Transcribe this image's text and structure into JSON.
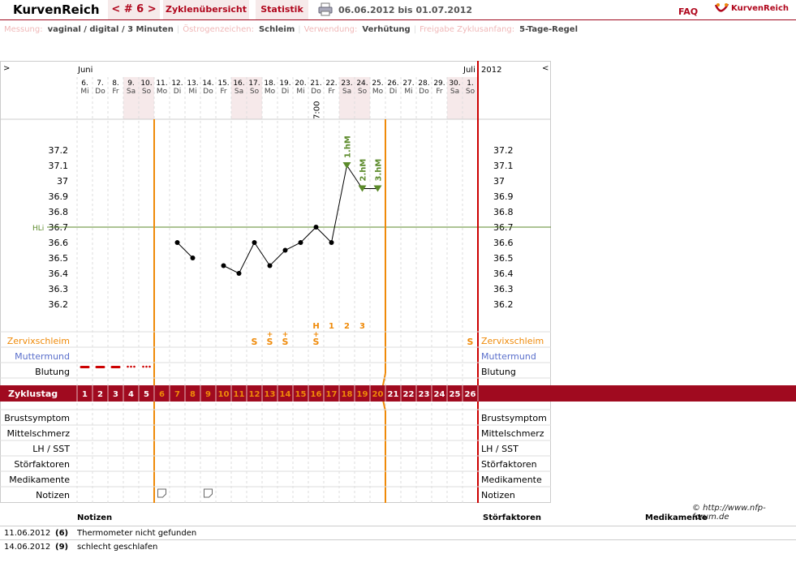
{
  "header": {
    "logo": "KurvenReich",
    "cycle_prev": "<",
    "cycle_num": "# 6",
    "cycle_next": ">",
    "tab_cycles": "Zyklenübersicht",
    "tab_stats": "Statistik",
    "date_range": "06.06.2012 bis 01.07.2012",
    "faq": "FAQ",
    "brand": "KurvenReich"
  },
  "info": [
    {
      "k": "Messung:",
      "v": "vaginal / digital / 3 Minuten"
    },
    {
      "k": "Östrogenzeichen:",
      "v": "Schleim"
    },
    {
      "k": "Verwendung:",
      "v": "Verhütung"
    },
    {
      "k": "Freigabe Zyklusanfang:",
      "v": "5-Tage-Regel"
    }
  ],
  "chart": {
    "nav_left": ">",
    "nav_right": "<",
    "month_start": "Juni",
    "month_end": "Juli",
    "year": "2012",
    "days": [
      {
        "d": "6.",
        "w": "Mi"
      },
      {
        "d": "7.",
        "w": "Do"
      },
      {
        "d": "8.",
        "w": "Fr"
      },
      {
        "d": "9.",
        "w": "Sa"
      },
      {
        "d": "10.",
        "w": "So"
      },
      {
        "d": "11.",
        "w": "Mo"
      },
      {
        "d": "12.",
        "w": "Di"
      },
      {
        "d": "13.",
        "w": "Mi"
      },
      {
        "d": "14.",
        "w": "Do"
      },
      {
        "d": "15.",
        "w": "Fr"
      },
      {
        "d": "16.",
        "w": "Sa"
      },
      {
        "d": "17.",
        "w": "So"
      },
      {
        "d": "18.",
        "w": "Mo"
      },
      {
        "d": "19.",
        "w": "Di"
      },
      {
        "d": "20.",
        "w": "Mi"
      },
      {
        "d": "21.",
        "w": "Do"
      },
      {
        "d": "22.",
        "w": "Fr"
      },
      {
        "d": "23.",
        "w": "Sa"
      },
      {
        "d": "24.",
        "w": "So"
      },
      {
        "d": "25.",
        "w": "Mo"
      },
      {
        "d": "26.",
        "w": "Di"
      },
      {
        "d": "27.",
        "w": "Mi"
      },
      {
        "d": "28.",
        "w": "Do"
      },
      {
        "d": "29.",
        "w": "Fr"
      },
      {
        "d": "30.",
        "w": "Sa"
      },
      {
        "d": "1.",
        "w": "So"
      }
    ],
    "time_label": "7:00",
    "time_day": 16,
    "yticks": [
      "37.2",
      "37.1",
      "37",
      "36.9",
      "36.8",
      "36.7",
      "36.6",
      "36.5",
      "36.4",
      "36.3",
      "36.2"
    ],
    "hili_label": "HLi",
    "hili_value": 36.7,
    "temps": [
      null,
      null,
      null,
      null,
      null,
      null,
      36.6,
      36.5,
      null,
      36.45,
      36.4,
      36.6,
      36.45,
      36.55,
      36.6,
      36.7,
      36.6,
      37.1,
      36.95,
      36.95,
      null,
      null,
      null,
      null,
      null,
      null
    ],
    "peak_labels": [
      {
        "day": 18,
        "t": "1.hM"
      },
      {
        "day": 19,
        "t": "2.hM"
      },
      {
        "day": 20,
        "t": "3.hM"
      }
    ],
    "hl_labels": [
      {
        "day": 16,
        "t": "H"
      },
      {
        "day": 17,
        "t": "1"
      },
      {
        "day": 18,
        "t": "2"
      },
      {
        "day": 19,
        "t": "3"
      }
    ],
    "mucus": [
      {
        "day": 12,
        "t": "S"
      },
      {
        "day": 13,
        "t": "S+"
      },
      {
        "day": 14,
        "t": "S+"
      },
      {
        "day": 16,
        "t": "S+"
      },
      {
        "day": 26,
        "t": "S"
      }
    ],
    "rows": {
      "zervix": "Zervixschleim",
      "mutter": "Muttermund",
      "blutung": "Blutung",
      "zyklustag": "Zyklustag",
      "brust": "Brustsymptom",
      "mittel": "Mittelschmerz",
      "lh": "LH / SST",
      "stoer": "Störfaktoren",
      "medi": "Medikamente",
      "notizen": "Notizen"
    },
    "bleeding": [
      "heavy",
      "heavy",
      "heavy",
      "light",
      "light"
    ],
    "cycle_days": [
      "1",
      "2",
      "3",
      "4",
      "5",
      "6",
      "7",
      "8",
      "9",
      "10",
      "11",
      "12",
      "13",
      "14",
      "15",
      "16",
      "17",
      "18",
      "19",
      "20",
      "21",
      "22",
      "23",
      "24",
      "25",
      "26"
    ],
    "fertile_from": 6,
    "fertile_to": 20,
    "note_days": [
      6,
      9
    ],
    "colors": {
      "accent": "#a00a1f",
      "orange": "#ef8a09",
      "green": "#5b8a2a",
      "blue": "#5a6fcb"
    }
  },
  "copyright": "© http://www.nfp-forum.de",
  "notes": {
    "h_notes": "Notizen",
    "h_stoer": "Störfaktoren",
    "h_medi": "Medikamente",
    "rows": [
      {
        "date": "11.06.2012",
        "day": "(6)",
        "text": "Thermometer nicht gefunden"
      },
      {
        "date": "14.06.2012",
        "day": "(9)",
        "text": "schlecht geschlafen"
      }
    ]
  }
}
